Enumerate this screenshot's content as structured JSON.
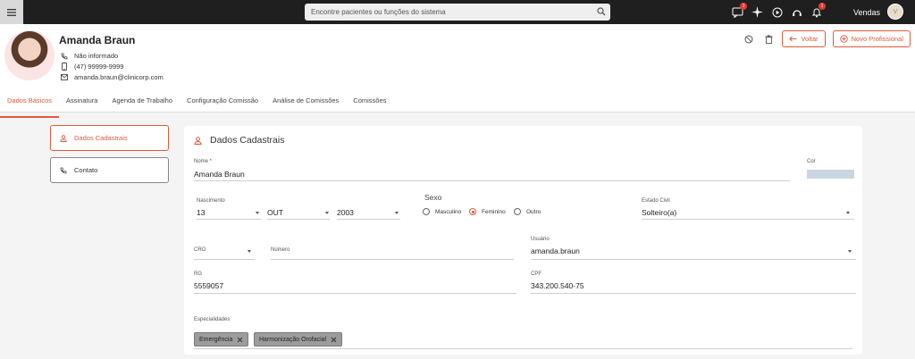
{
  "topbar": {
    "search_placeholder": "Encontre pacientes ou funções do sistema",
    "icons": [
      "menu-icon",
      "search-icon",
      "messages-icon",
      "ai-sparkle-icon",
      "play-icon",
      "support-icon",
      "notifications-icon"
    ],
    "messages_badge": "1",
    "notifications_badge": "1",
    "user_label": "Vendas",
    "user_avatar": "V"
  },
  "profile": {
    "name": "Amanda Braun",
    "gender_info": "Não informado",
    "phone": "(47) 99999-9999",
    "email": "amanda.braun@clinicorp.com"
  },
  "actions": {
    "back_label": "Voltar",
    "new_label": "Novo Profissional"
  },
  "tabs": [
    "Dados Básicos",
    "Assinatura",
    "Agenda de Trabalho",
    "Configuração Comissão",
    "Análise de Comissões",
    "Comissões"
  ],
  "side_menu": [
    "Dados Cadastrais",
    "Contato"
  ],
  "form": {
    "title": "Dados Cadastrais",
    "nome_label": "Nome *",
    "nome_value": "Amanda Braun",
    "cor_label": "Cor",
    "cor_value": "#c9d5e1",
    "nascimento_label": "Nascimento",
    "dia": "13",
    "mes": "OUT",
    "ano": "2003",
    "sexo_label": "Sexo",
    "sexo_options": [
      "Masculino",
      "Feminino",
      "Outro"
    ],
    "sexo_selected": "Feminino",
    "estado_civil_label": "Estado Civil",
    "estado_civil_value": "Solteiro(a)",
    "cro_label": "CRO",
    "numero_label": "Número",
    "usuario_label": "Usuário",
    "usuario_value": "amanda.braun",
    "rg_label": "RG",
    "rg_value": "5559057",
    "cpf_label": "CPF",
    "cpf_value": "343.200.540-75",
    "especialidades_label": "Especialidades",
    "especialidades": [
      "Emergência",
      "Harmonização Orofacial"
    ]
  },
  "colors": {
    "accent": "#e05a3a",
    "topbar": "#1f1f1f",
    "badge": "#e53935"
  }
}
